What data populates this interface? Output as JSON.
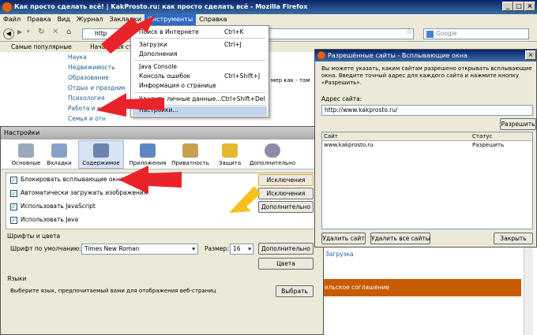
{
  "firefox": {
    "title": "Как просто сделать всё! | KakProsto.ru: как просто сделать всё - Mozilla Firefox",
    "menu": [
      "Файл",
      "Правка",
      "Вид",
      "Журнал",
      "Закладки",
      "Инструменты",
      "Справка"
    ],
    "url": "http",
    "search_placeholder": "Google",
    "bookmarks": [
      "Самые популярные",
      "Начальная стра"
    ],
    "sidebar_links": [
      "Наука",
      "Недвижимость",
      "Образование",
      "Отдых и праздник",
      "Психология",
      "Работа и карье",
      "Семья и отн"
    ],
    "page_snippet": "мер как - там"
  },
  "tools_menu": {
    "items": [
      {
        "label": "Поиск в Интернете",
        "shortcut": "Ctrl+K"
      },
      {
        "label": "Загрузки",
        "shortcut": "Ctrl+J"
      },
      {
        "label": "Дополнения",
        "shortcut": ""
      },
      {
        "label": "Java Console",
        "shortcut": ""
      },
      {
        "label": "Консоль ошибок",
        "shortcut": "Ctrl+Shift+J"
      },
      {
        "label": "Информация о странице",
        "shortcut": ""
      },
      {
        "label": "Удалить личные данные...",
        "shortcut": "Ctrl+Shift+Del"
      },
      {
        "label": "Настройки...",
        "shortcut": ""
      }
    ]
  },
  "prefs": {
    "title": "Настройки",
    "tabs": [
      "Основные",
      "Вкладки",
      "Содержимое",
      "Приложения",
      "Приватность",
      "Защита",
      "Дополнительно"
    ],
    "options": [
      {
        "label": "Блокировать всплывающие окна",
        "checked": true,
        "button": "Исключения"
      },
      {
        "label": "Автоматически загружать изображения",
        "checked": true,
        "button": "Исключения"
      },
      {
        "label": "Использовать JavaScript",
        "checked": true,
        "button": "Дополнительно"
      },
      {
        "label": "Использовать Java",
        "checked": true,
        "button": ""
      }
    ],
    "fonts_section": "Шрифты и цвета",
    "default_font_label": "Шрифт по умолчанию:",
    "default_font": "Times New Roman",
    "size_label": "Размер:",
    "size_value": "16",
    "more_button": "Дополнительно",
    "colors_button": "Цвета",
    "lang_section": "Языки",
    "lang_text": "Выберите язык, предпочитаемый вами для отображения веб-страниц",
    "choose_button": "Выбрать"
  },
  "popup_dialog": {
    "title": "Разрешённые сайты - Всплывающие окна",
    "description": "Вы можете указать, каким сайтам разрешено открывать всплывающие окна. Введите точный адрес для каждого сайта и нажмите кнопку «Разрешить».",
    "address_label": "Адрес сайта:",
    "address_value": "http://www.kakprosto.ru/",
    "allow_button": "Разрешить",
    "col_site": "Сайт",
    "col_status": "Статус",
    "rows": [
      {
        "site": "www.kakprosto.ru",
        "status": "Разрешить"
      }
    ],
    "remove_button": "Удалить сайт",
    "remove_all_button": "Удалить все сайты",
    "close_button": "Закрыть"
  },
  "background_page": {
    "snippet_link": "Загрузка",
    "banner_text": "ельское соглашение"
  },
  "colors": {
    "arrow_red": "#e8232a",
    "arrow_yellow": "#f4c21b",
    "banner": "#c85a00"
  }
}
